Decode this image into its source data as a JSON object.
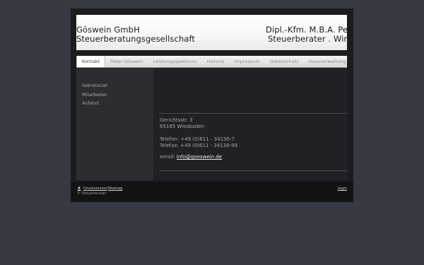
{
  "header": {
    "left_line1": "Göswein GmbH",
    "left_line2": "Steuerberatungsgesellschaft",
    "right_line1": "Dipl.-Kfm. M.B.A. Peter",
    "right_line2": "Steuerberater . Wirtsch"
  },
  "nav": {
    "items": [
      {
        "label": "Kontakt"
      },
      {
        "label": "Peter Göswein"
      },
      {
        "label": "Leistungsspektrum"
      },
      {
        "label": "Historie"
      },
      {
        "label": "Impressum"
      },
      {
        "label": "Datenschutz"
      },
      {
        "label": "Hausverwaltung"
      }
    ]
  },
  "sidebar": {
    "items": [
      {
        "label": "Sekretariat"
      },
      {
        "label": "Mitarbeiter"
      },
      {
        "label": "Anfahrt"
      }
    ]
  },
  "content": {
    "street": "Gerichtsstr. 3",
    "city": "65185 Wiesbaden",
    "phone": "Telefon: +49 (0)611 - 34130-7",
    "fax": "Telefax: +49 (0)611 - 34130-99",
    "email_label": "email: ",
    "email": "info@goeswein.de"
  },
  "footer": {
    "print_label": "Druckversion",
    "separator": " | ",
    "sitemap_label": "Sitemap",
    "copyright": "© Steuerberater",
    "login_label": "Login"
  }
}
